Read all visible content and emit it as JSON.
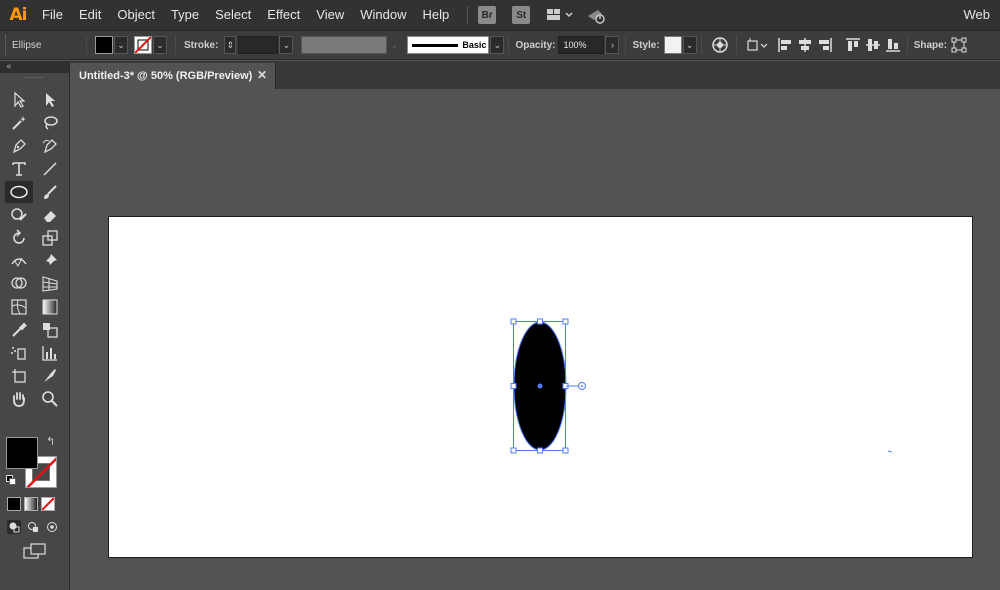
{
  "app": {
    "logo": "Ai"
  },
  "menu": [
    "File",
    "Edit",
    "Object",
    "Type",
    "Select",
    "Effect",
    "View",
    "Window",
    "Help"
  ],
  "menu_icons": {
    "bridge": "Br",
    "stock": "St"
  },
  "workspace": "Web",
  "control": {
    "selection_label": "Ellipse",
    "stroke_label": "Stroke:",
    "brush_label": "Basic",
    "opacity_label": "Opacity:",
    "opacity_value": "100%",
    "style_label": "Style:",
    "shape_label": "Shape:"
  },
  "document": {
    "tab_title": "Untitled-3* @ 50% (RGB/Preview)"
  },
  "colors": {
    "selection": "#4f7bff",
    "fill": "#000000",
    "artboard": "#ffffff",
    "pasteboard": "#535353",
    "app_logo": "#ff9a00"
  },
  "tools": [
    "selection-tool",
    "direct-selection-tool",
    "magic-wand-tool",
    "lasso-tool",
    "pen-tool",
    "curvature-tool",
    "type-tool",
    "line-segment-tool",
    "ellipse-tool",
    "paintbrush-tool",
    "shaper-tool",
    "eraser-tool",
    "rotate-tool",
    "scale-tool",
    "width-tool",
    "puppet-warp-tool",
    "shape-builder-tool",
    "perspective-grid-tool",
    "mesh-tool",
    "gradient-tool",
    "eyedropper-tool",
    "blend-tool",
    "symbol-sprayer-tool",
    "column-graph-tool",
    "artboard-tool",
    "slice-tool",
    "hand-tool",
    "zoom-tool"
  ]
}
